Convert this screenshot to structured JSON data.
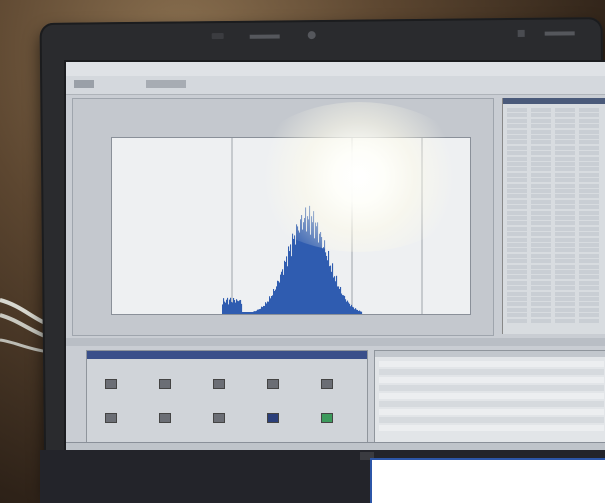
{
  "photo": {
    "subject": "",
    "bezel_labels": {
      "left": "",
      "right": ""
    }
  },
  "screen": {
    "plot": {
      "chart_type": "histogram",
      "color": "#2f5cb0"
    },
    "colors": {
      "screen_bg": "#c9cdd3",
      "plot_bg": "#eef0f2",
      "bar_color": "#2f5cb0",
      "glare": "#ffffff"
    }
  },
  "icons": {
    "camera_icons": [
      "camera-icon",
      "camera-icon",
      "camera-icon",
      "camera-icon",
      "camera-icon",
      "camera-icon",
      "camera-icon",
      "camera-icon",
      "camera-icon",
      "camera-icon"
    ],
    "led": "power-led-icon"
  }
}
